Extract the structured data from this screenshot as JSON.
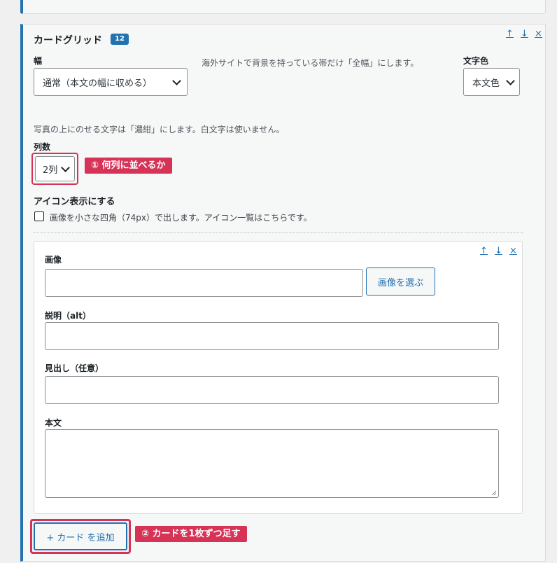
{
  "panel": {
    "title": "カードグリッド",
    "badge": "12",
    "controls": {
      "up": "↑",
      "down": "↓",
      "close": "×"
    },
    "width_label": "幅",
    "width_value": "通常（本文の幅に収める）",
    "width_help": "海外サイトで背景を持っている帯だけ「全幅」にします。",
    "text_color_label": "文字色",
    "text_color_value": "本文色",
    "photo_note": "写真の上にのせる文字は「濃紺」にします。白文字は使いません。",
    "columns_label": "列数",
    "columns_value": "2列",
    "annotation1": "① 何列に並べるか",
    "icon_label": "アイコン表示にする",
    "icon_checkbox_text": "画像を小さな四角（74px）で出します。アイコン一覧はこちらです。",
    "icon_checked": false
  },
  "card": {
    "controls": {
      "up": "↑",
      "down": "↓",
      "close": "×"
    },
    "image_label": "画像",
    "image_value": "",
    "choose_image_button": "画像を選ぶ",
    "alt_label": "説明（alt）",
    "alt_value": "",
    "heading_label": "見出し（任意）",
    "heading_value": "",
    "body_label": "本文",
    "body_value": ""
  },
  "add_card_button": "+ カード を追加",
  "annotation2": "② カードを1枚ずつ足す",
  "colors": {
    "accent": "#2271b1",
    "annotation": "#d63357",
    "panel_bg": "#f6f7f7",
    "page_bg": "#f0f0f1"
  }
}
